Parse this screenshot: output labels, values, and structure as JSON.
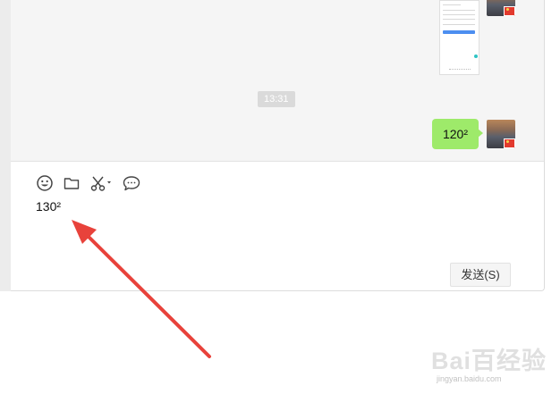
{
  "chat": {
    "timestamp": "13:31",
    "sent_message": "120²"
  },
  "composer": {
    "text": "130²",
    "send_label": "发送(S)",
    "tools": [
      "emoji-icon",
      "folder-icon",
      "scissors-icon",
      "chat-history-icon"
    ]
  },
  "colors": {
    "bubble": "#9eea6a",
    "arrow": "#e8423b",
    "chat_bg": "#f5f5f5"
  },
  "watermark": {
    "logo": "Bai百经验",
    "url": "jingyan.baidu.com"
  }
}
